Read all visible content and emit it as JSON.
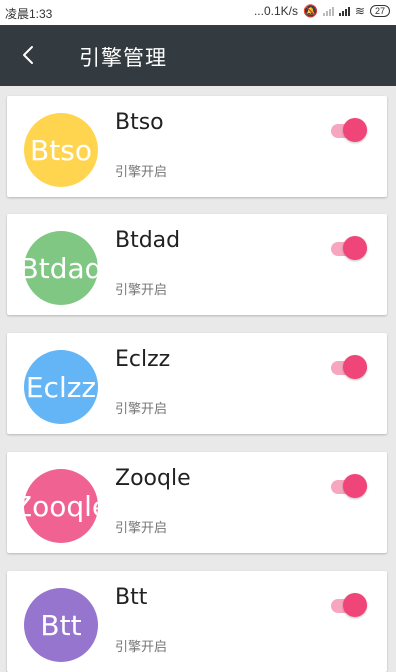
{
  "statusbar": {
    "time": "凌晨1:33",
    "speed": "...0.1K/s",
    "battery": "27"
  },
  "appbar": {
    "title": "引擎管理"
  },
  "engines": [
    {
      "name": "Btso",
      "avatar_text": "Btso",
      "avatar_color": "#ffd54f",
      "status": "引擎开启",
      "enabled": true
    },
    {
      "name": "Btdad",
      "avatar_text": "Btdad",
      "avatar_color": "#81c784",
      "status": "引擎开启",
      "enabled": true
    },
    {
      "name": "Eclzz",
      "avatar_text": "Eclzz",
      "avatar_color": "#64b5f6",
      "status": "引擎开启",
      "enabled": true
    },
    {
      "name": "Zooqle",
      "avatar_text": "Zooqle",
      "avatar_color": "#f06292",
      "status": "引擎开启",
      "enabled": true
    },
    {
      "name": "Btt",
      "avatar_text": "Btt",
      "avatar_color": "#9575cd",
      "status": "引擎开启",
      "enabled": true
    }
  ]
}
